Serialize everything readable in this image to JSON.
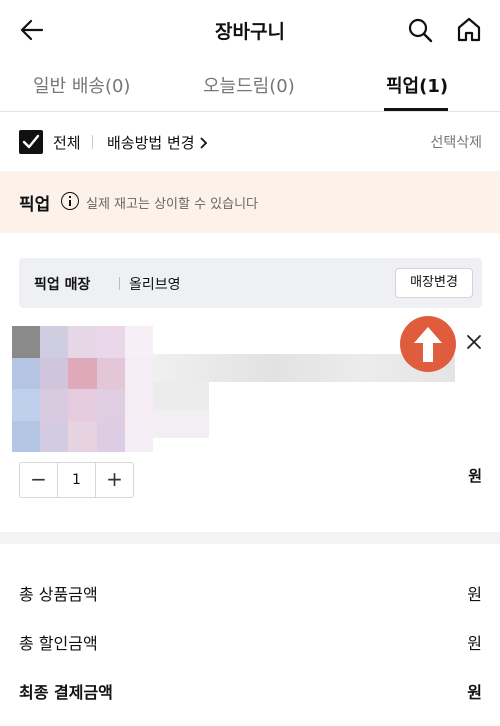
{
  "header": {
    "title": "장바구니"
  },
  "tabs": [
    {
      "label": "일반 배송(0)"
    },
    {
      "label": "오늘드림(0)"
    },
    {
      "label": "픽업(1)"
    }
  ],
  "select_bar": {
    "select_all_label": "전체",
    "shipping_change_label": "배송방법 변경",
    "delete_selected_label": "선택삭제"
  },
  "pickup_notice": {
    "title": "픽업",
    "text": "실제 재고는 상이할 수 있습니다"
  },
  "store": {
    "label": "픽업 매장",
    "name": "올리브영",
    "change_button": "매장변경"
  },
  "product": {
    "quantity": "1",
    "price_currency": "원"
  },
  "summary": {
    "total_product_label": "총 상품금액",
    "total_product_value": "원",
    "total_discount_label": "총 할인금액",
    "total_discount_value": "원",
    "final_label": "최종 결제금액",
    "final_value": "원"
  },
  "colors": {
    "accent_orange": "#df5d3c",
    "notice_bg": "#fcf2ea",
    "store_bg": "#eef0f4"
  }
}
